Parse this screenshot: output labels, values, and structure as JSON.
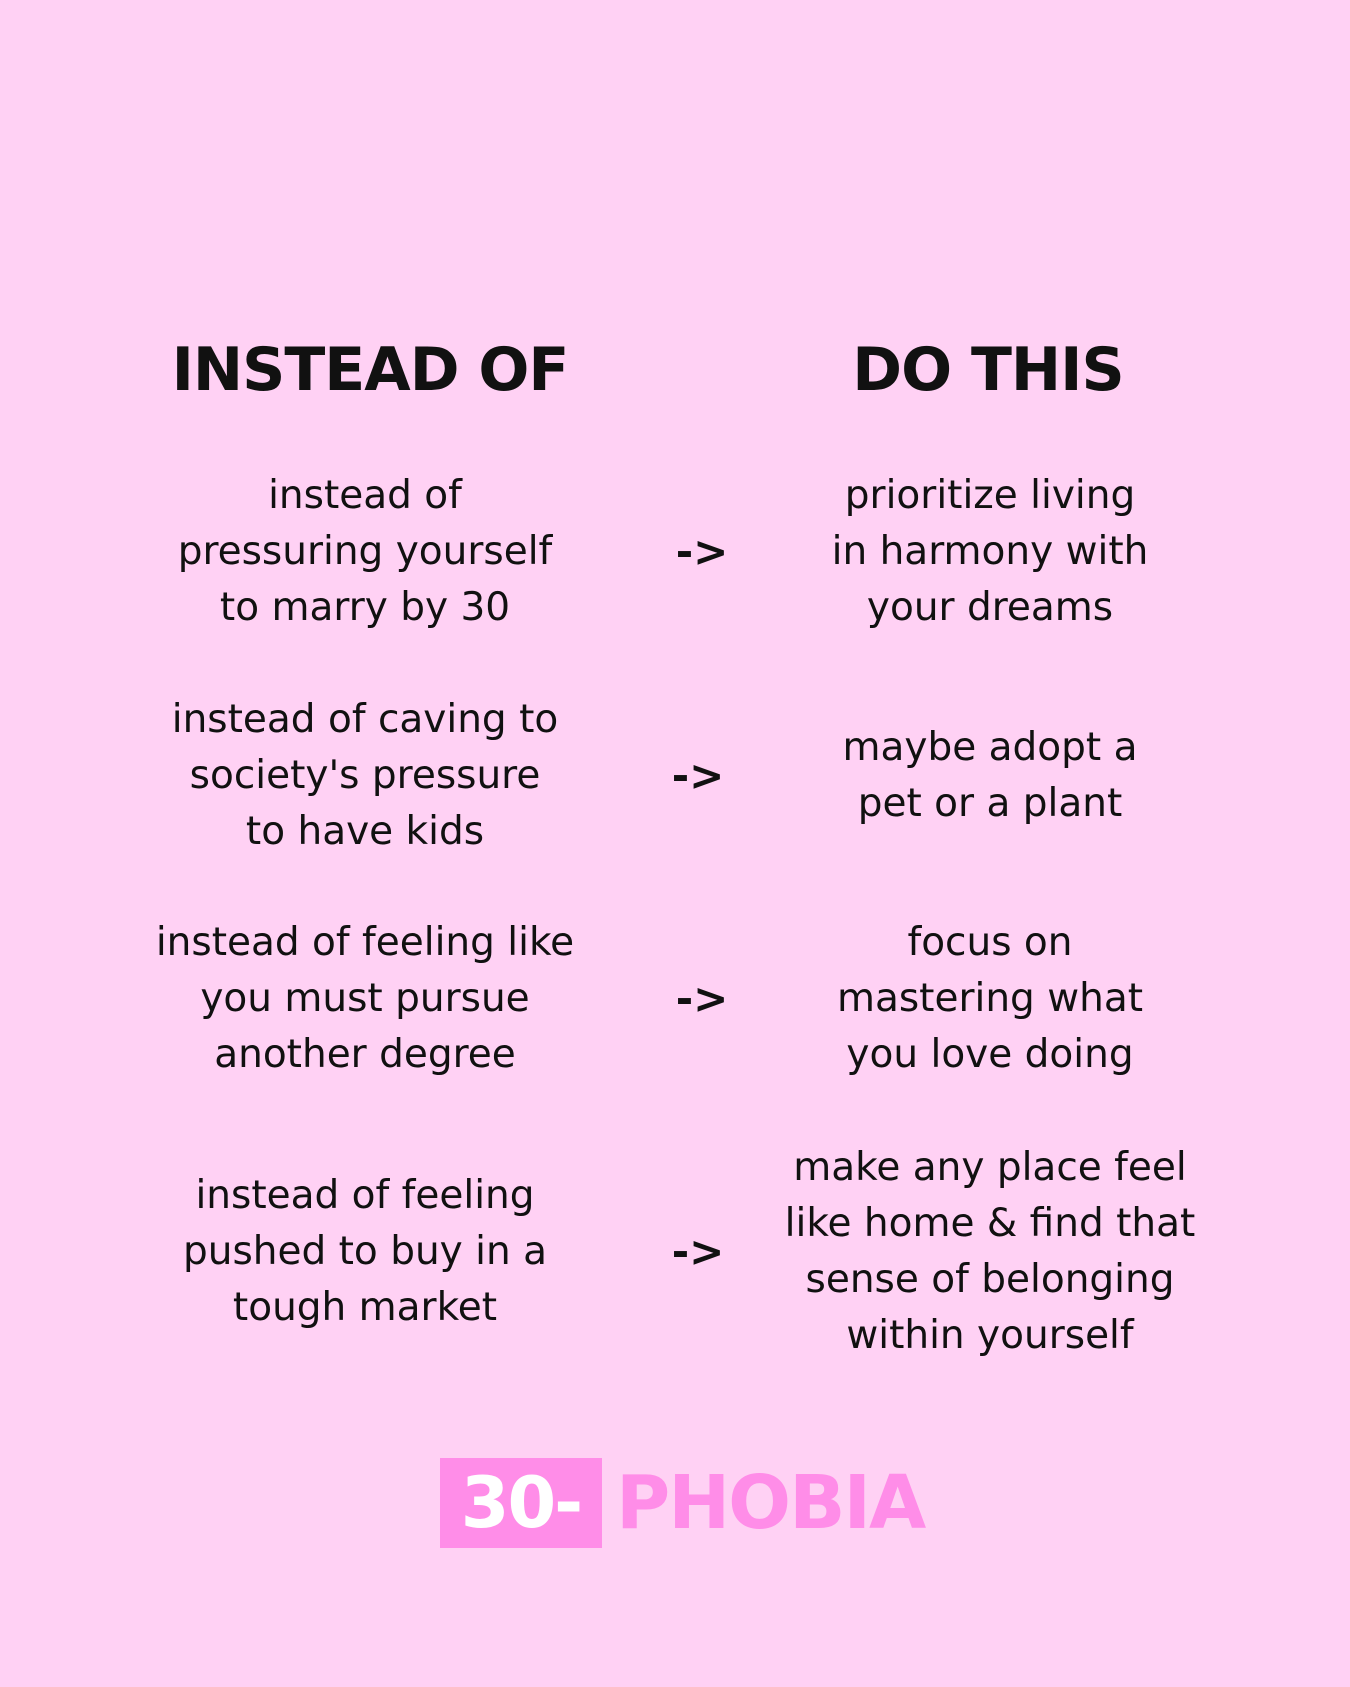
{
  "headers": {
    "left": "INSTEAD OF",
    "right": "DO THIS"
  },
  "arrow": "->",
  "rows": [
    {
      "left": [
        "instead of",
        "pressuring yourself",
        "to marry by 30"
      ],
      "right": [
        "prioritize living",
        "in harmony with",
        "your dreams"
      ]
    },
    {
      "left": [
        "instead of caving to",
        "society's pressure",
        "to have kids"
      ],
      "right": [
        "maybe adopt a",
        "pet or a plant"
      ]
    },
    {
      "left": [
        "instead of feeling like",
        "you must pursue",
        "another degree"
      ],
      "right": [
        "focus on",
        "mastering what",
        "you love doing"
      ]
    },
    {
      "left": [
        "instead of feeling",
        "pushed to buy in a",
        "tough market"
      ],
      "right": [
        "make any place feel",
        "like home & find that",
        "sense of belonging",
        "within yourself"
      ]
    }
  ],
  "logo": {
    "box": "30-",
    "text": "PHOBIA"
  },
  "colors": {
    "background": "#ffd1f4",
    "accent": "#ff8de8",
    "text": "#111111"
  }
}
